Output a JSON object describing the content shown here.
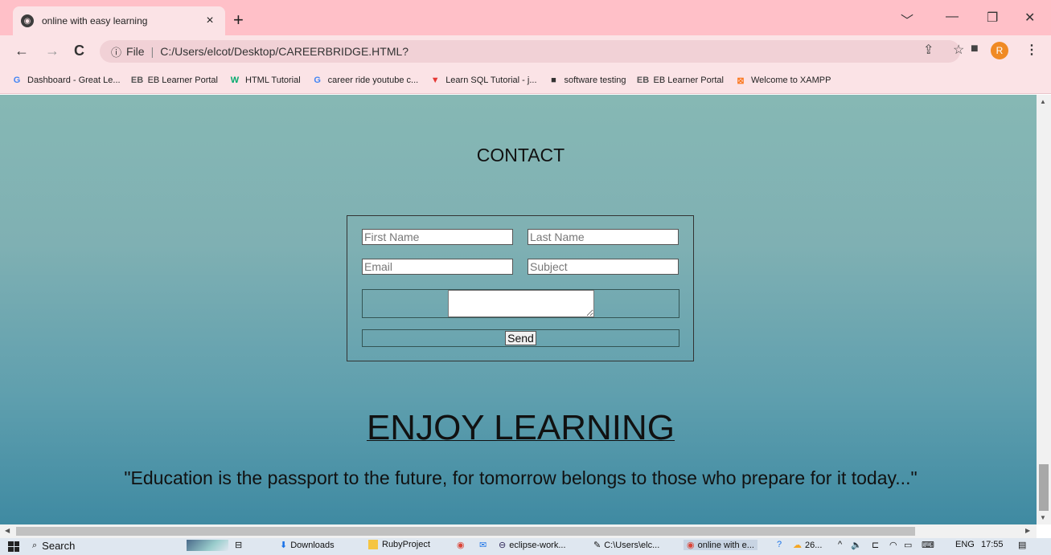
{
  "browser": {
    "tab_title": "online with easy learning",
    "tab_close": "×",
    "new_tab": "+",
    "window_controls": [
      "﹀",
      "—",
      "❐",
      "✕"
    ],
    "nav": {
      "back": "←",
      "forward": "→",
      "reload": "C"
    },
    "address": {
      "info": "ⓘ",
      "scheme": "File",
      "url": "C:/Users/elcot/Desktop/CAREERBRIDGE.HTML?"
    },
    "profile_initial": "R",
    "bookmarks": [
      {
        "icon": "G",
        "label": "Dashboard - Great Le...",
        "color": "#4285f4"
      },
      {
        "icon": "EB",
        "label": "EB Learner Portal",
        "color": "#555555"
      },
      {
        "icon": "W",
        "label": "HTML Tutorial",
        "color": "#04aa6d"
      },
      {
        "icon": "G",
        "label": "career ride youtube c...",
        "color": "#4285f4"
      },
      {
        "icon": "▼",
        "label": "Learn SQL Tutorial - j...",
        "color": "#e53935"
      },
      {
        "icon": "■",
        "label": "software testing",
        "color": "#333333"
      },
      {
        "icon": "EB",
        "label": "EB Learner Portal",
        "color": "#555555"
      },
      {
        "icon": "⊠",
        "label": "Welcome to XAMPP",
        "color": "#fb7a24"
      }
    ]
  },
  "page": {
    "contact_title": "CONTACT",
    "form": {
      "first_name_placeholder": "First Name",
      "last_name_placeholder": "Last Name",
      "email_placeholder": "Email",
      "subject_placeholder": "Subject",
      "send_label": "Send"
    },
    "headline": "ENJOY LEARNING",
    "quote": "\"Education is the passport to the future, for tomorrow belongs to those who prepare for it today...\""
  },
  "taskbar": {
    "search": "Search",
    "items": [
      "Downloads",
      "RubyProject",
      "eclipse-work...",
      "C:\\Users\\elc...",
      "online with e..."
    ],
    "weather": "26...",
    "lang": "ENG",
    "time": "17:55"
  }
}
